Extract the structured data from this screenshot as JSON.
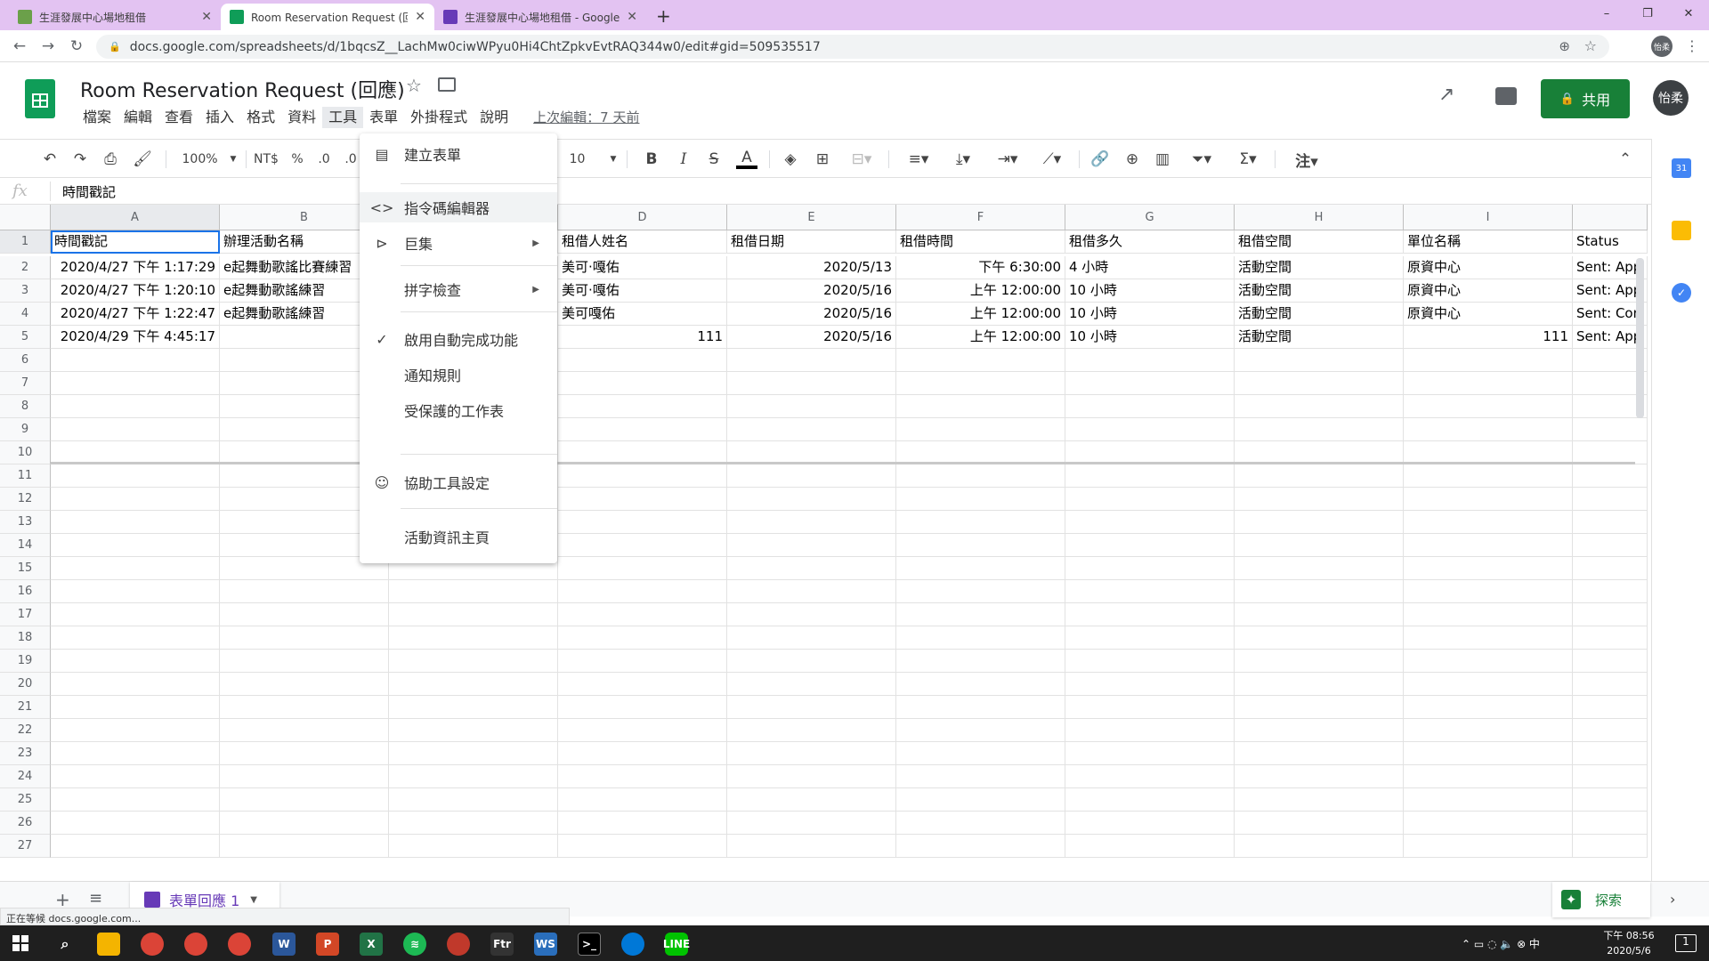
{
  "browser": {
    "tabs": [
      {
        "title": "生涯發展中心場地租借",
        "fav_color": "#6ba04a"
      },
      {
        "title": "Room Reservation Request (回...",
        "fav_color": "#0f9d58"
      },
      {
        "title": "生涯發展中心場地租借 - Google...",
        "fav_color": "#673ab7"
      }
    ],
    "new_tab": "+",
    "url": "docs.google.com/spreadsheets/d/1bqcsZ__LachMw0ciwWPyu0Hi4ChtZpkvEvtRAQ344w0/edit#gid=509535517",
    "profile": "怡柔",
    "win": {
      "min": "–",
      "max": "❐",
      "close": "✕"
    }
  },
  "app": {
    "title": "Room Reservation Request (回應)",
    "menus": [
      "檔案",
      "編輯",
      "查看",
      "插入",
      "格式",
      "資料",
      "工具",
      "表單",
      "外掛程式",
      "說明"
    ],
    "last_edit": "上次編輯：7 天前",
    "share_label": "共用",
    "avatar": "怡柔"
  },
  "toolbar": {
    "zoom": "100%",
    "currency": "NT$",
    "percent": "%",
    "dec_less": ".0",
    "dec_more": ".0",
    "font_size": "10"
  },
  "formula_bar": {
    "fx": "fx",
    "value": "時間戳記"
  },
  "grid": {
    "columns": [
      "A",
      "B",
      "C",
      "D",
      "E",
      "F",
      "G",
      "H",
      "I",
      ""
    ],
    "row_numbers": [
      "1",
      "2",
      "3",
      "4",
      "5",
      "6",
      "7",
      "8",
      "9",
      "10",
      "11",
      "12",
      "13",
      "14",
      "15",
      "16",
      "17",
      "18",
      "19",
      "20",
      "21",
      "22",
      "23",
      "24",
      "25",
      "26",
      "27"
    ],
    "header_row": [
      "時間戳記",
      "辦理活動名稱",
      "",
      "租借人姓名",
      "租借日期",
      "租借時間",
      "租借多久",
      "租借空間",
      "單位名稱",
      "Status"
    ],
    "rows": [
      [
        "2020/4/27 下午 1:17:29",
        "e起舞動歌謠比賽練習",
        "",
        "美可·嘎佑",
        "2020/5/13",
        "下午 6:30:00",
        "4 小時",
        "活動空間",
        "原資中心",
        "Sent: App"
      ],
      [
        "2020/4/27 下午 1:20:10",
        "e起舞動歌謠練習",
        "",
        "美可·嘎佑",
        "2020/5/16",
        "上午 12:00:00",
        "10 小時",
        "活動空間",
        "原資中心",
        "Sent: App"
      ],
      [
        "2020/4/27 下午 1:22:47",
        "e起舞動歌謠練習",
        "",
        "美可嘎佑",
        "2020/5/16",
        "上午 12:00:00",
        "10 小時",
        "活動空間",
        "原資中心",
        "Sent: Con"
      ],
      [
        "2020/4/29 下午 4:45:17",
        "",
        "",
        "111",
        "2020/5/16",
        "上午 12:00:00",
        "10 小時",
        "活動空間",
        "111",
        "Sent: App"
      ]
    ]
  },
  "tools_menu": {
    "items": [
      {
        "label": "建立表單",
        "icon": "form-icon"
      },
      {
        "label": "指令碼編輯器",
        "icon": "code-icon"
      },
      {
        "label": "巨集",
        "icon": "play-icon",
        "submenu": true
      },
      {
        "label": "拼字檢查",
        "icon": "",
        "submenu": true
      },
      {
        "label": "啟用自動完成功能",
        "icon": "check-icon"
      },
      {
        "label": "通知規則",
        "icon": ""
      },
      {
        "label": "受保護的工作表",
        "icon": ""
      },
      {
        "label": "協助工具設定",
        "icon": "accessibility-icon"
      },
      {
        "label": "活動資訊主頁",
        "icon": ""
      }
    ]
  },
  "sheet_tabs": {
    "add": "+",
    "list": "≡",
    "active_tab": "表單回應 1",
    "explore": "探索"
  },
  "status_bar": {
    "text": "正在等候 docs.google.com..."
  },
  "taskbar": {
    "time": "下午 08:56",
    "date": "2020/5/6",
    "notifications": "1"
  },
  "colors": {
    "sheets_green": "#0f9d58",
    "share_green": "#188038",
    "tab_strip": "#e3c3f2",
    "selection_blue": "#1a73e8"
  }
}
